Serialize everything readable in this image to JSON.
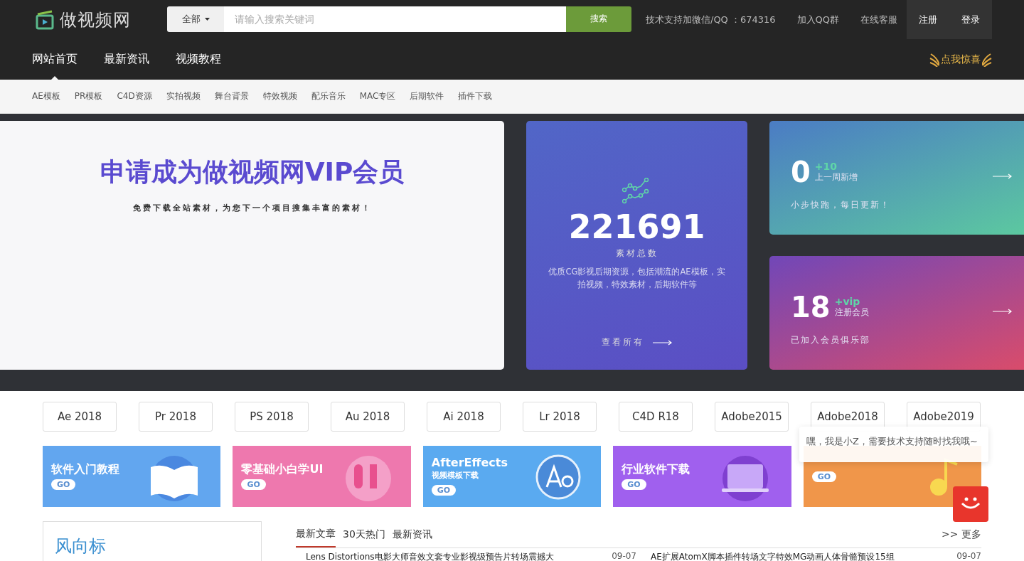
{
  "header": {
    "logo_text": "做视频网",
    "search": {
      "scope": "全部",
      "placeholder": "请输入搜索关键词",
      "button": "搜索"
    },
    "links": [
      "技术支持加微信/QQ ：674316",
      "加入QQ群",
      "在线客服"
    ],
    "auth": [
      "注册",
      "登录"
    ]
  },
  "nav": [
    {
      "label": "网站首页",
      "selected": true
    },
    {
      "label": "最新资讯",
      "selected": false
    },
    {
      "label": "视频教程",
      "selected": false
    }
  ],
  "promo": "点我惊喜",
  "subnav": [
    "AE模板",
    "PR模板",
    "C4D资源",
    "实拍视频",
    "舞台背景",
    "特效视频",
    "配乐音乐",
    "MAC专区",
    "后期软件",
    "插件下载"
  ],
  "hero": {
    "title": "申请成为做视频网VIP会员",
    "subtitle": "免费下载全站素材，为您下一个项目搜集丰富的素材！"
  },
  "total_card": {
    "number": "221691",
    "label": "素材总数",
    "description": "优质CG影视后期资源，包括潮流的AE模板，实拍视频，特效素材，后期软件等",
    "link": "查看所有"
  },
  "stat_cards": [
    {
      "number": "0",
      "delta": "+10",
      "caption": "上一周新增",
      "note": "小步快跑，每日更新！",
      "kind": "teal"
    },
    {
      "number": "18",
      "delta": "+vip",
      "caption": "注册会员",
      "note": "已加入会员俱乐部",
      "kind": "magenta"
    }
  ],
  "software_tags": [
    "Ae 2018",
    "Pr 2018",
    "PS 2018",
    "Au 2018",
    "Ai 2018",
    "Lr 2018",
    "C4D R18",
    "Adobe2015",
    "Adobe2018",
    "Adobe2019"
  ],
  "banners": [
    {
      "kind": "book",
      "title": "软件入门教程",
      "go": "GO"
    },
    {
      "kind": "ui",
      "title": "零基础小白学UI",
      "go": "GO"
    },
    {
      "kind": "ae",
      "title": "AfterEffects",
      "subtitle": "视频模板下载",
      "go": "GO"
    },
    {
      "kind": "laptop",
      "title": "行业软件下载",
      "go": "GO"
    },
    {
      "kind": "music",
      "go": "GO"
    }
  ],
  "chat_tooltip": "嘿，我是小Z，需要技术支持随时找我哦~",
  "wind_panel": {
    "title": "风向标"
  },
  "article_tabs": [
    {
      "label": "最新文章",
      "selected": true
    },
    {
      "label": "30天热门",
      "selected": false
    },
    {
      "label": "最新资讯",
      "selected": false
    }
  ],
  "more": ">> 更多",
  "articles": [
    {
      "title": "Lens Distortions电影大师音效文套专业影视级预告片转场震撼大",
      "date": "09-07"
    },
    {
      "title": "AE扩展AtomX脚本插件转场文字特效MG动画人体骨骼预设15组",
      "date": "09-07"
    }
  ]
}
